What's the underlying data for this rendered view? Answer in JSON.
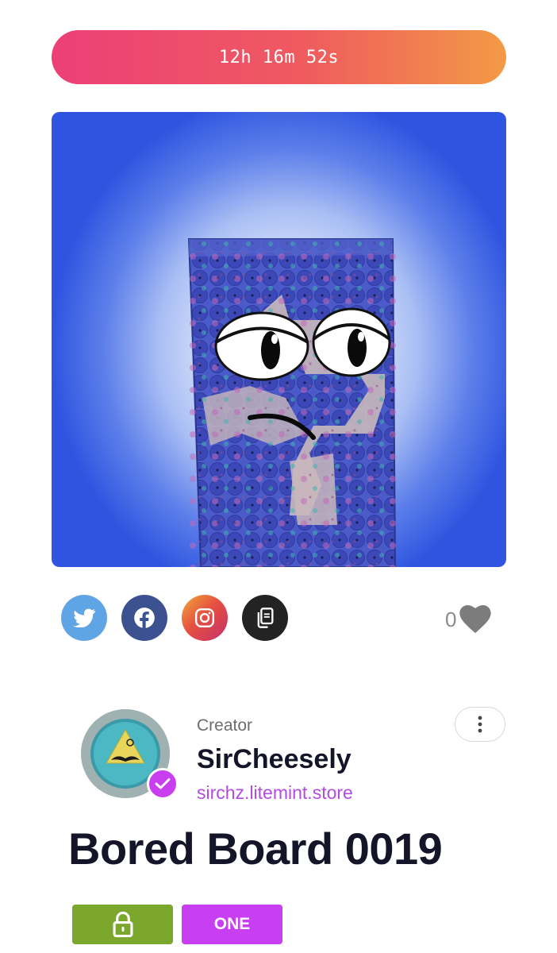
{
  "auction": {
    "countdown": "12h 16m 52s"
  },
  "artwork": {
    "subject": "bored-board-character"
  },
  "share": {
    "buttons": [
      {
        "icon": "twitter-icon",
        "color": "#5fa5e6"
      },
      {
        "icon": "facebook-icon",
        "color": "#3b5190"
      },
      {
        "icon": "instagram-icon",
        "color": "#e5513f"
      },
      {
        "icon": "copy-icon",
        "color": "#232323"
      }
    ]
  },
  "likes": {
    "count": "0",
    "icon": "heart-icon"
  },
  "creator": {
    "label": "Creator",
    "name": "SirCheesely",
    "link": "sirchz.litemint.store",
    "avatar_text": "Sir Cheesely",
    "verified": true
  },
  "nft": {
    "title": "Bored Board 0019"
  },
  "badges": {
    "lock_icon": "lock-icon",
    "edition": "ONE"
  },
  "colors": {
    "accent_purple": "#c73ff0",
    "lock_green": "#7aa72c",
    "timer_gradient_start": "#ec3f78",
    "timer_gradient_end": "#f29a45"
  }
}
